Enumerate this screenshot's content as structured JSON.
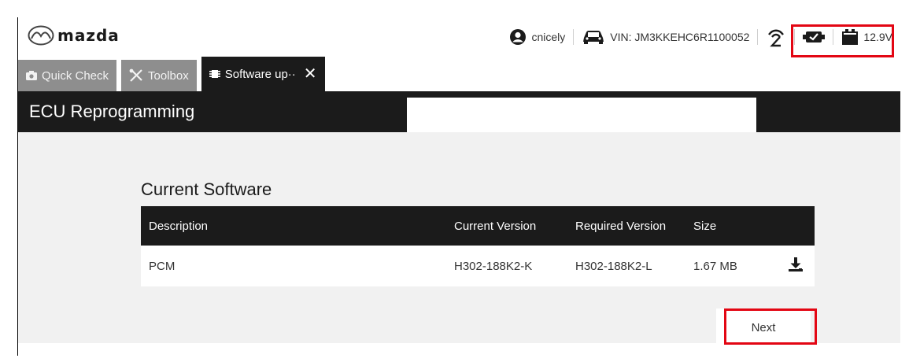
{
  "brand": {
    "logo_text": "mazda",
    "logo_icon": "mazda-logo-icon"
  },
  "status": {
    "username": "cnicely",
    "vin": "VIN: JM3KKEHC6R1100052",
    "battery_voltage": "12.9V",
    "icons": [
      "user-icon",
      "car-icon",
      "signal-icon",
      "vci-icon",
      "battery-icon"
    ]
  },
  "tabs": [
    {
      "label": "Quick Check",
      "icon": "camera-icon"
    },
    {
      "label": "Toolbox",
      "icon": "tools-icon"
    },
    {
      "label": "Software up··",
      "icon": "chip-icon",
      "active": true
    }
  ],
  "page": {
    "title": "ECU Reprogramming"
  },
  "software": {
    "section_title": "Current Software",
    "columns": [
      "Description",
      "Current Version",
      "Required Version",
      "Size"
    ],
    "rows": [
      {
        "description": "PCM",
        "current_version": "H302-188K2-K",
        "required_version": "H302-188K2-L",
        "size": "1.67 MB"
      }
    ]
  },
  "actions": {
    "next_label": "Next"
  },
  "colors": {
    "highlight": "#e30613",
    "dark": "#1b1b1b",
    "tab_inactive": "#8e8e8e",
    "content_bg": "#f1f1f1"
  }
}
